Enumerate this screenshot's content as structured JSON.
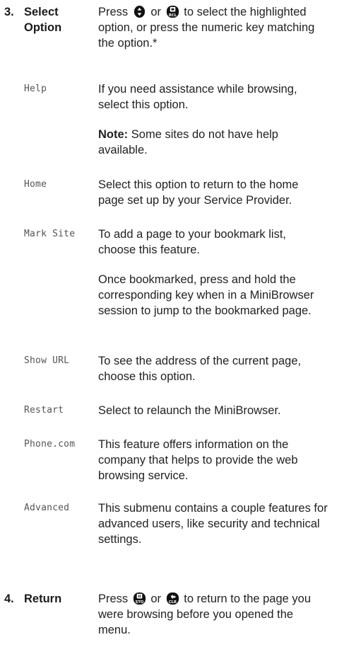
{
  "step3": {
    "number": "3.",
    "title_line1": "Select",
    "title_line2": "Option",
    "desc_a": "Press",
    "desc_or": "or",
    "desc_b": "to select the highlighted",
    "desc_line2": "option, or press the numeric key matching",
    "desc_line3": "the option.*"
  },
  "options": [
    {
      "label": "Help",
      "lines": [
        "If you need assistance while browsing,",
        "select this option."
      ],
      "note_label": "Note:",
      "note_rest": "Some sites do not have help",
      "note_line2": "available."
    },
    {
      "label": "Home",
      "lines": [
        "Select this option to return to the home",
        "page set up by your Service Provider."
      ]
    },
    {
      "label": "Mark Site",
      "lines": [
        "To add a page to your bookmark list,",
        "choose this feature."
      ],
      "extra": [
        "Once bookmarked, press and hold the",
        "corresponding key when in a MiniBrowser",
        "session to jump to the bookmarked page."
      ]
    },
    {
      "label": "Show URL",
      "lines": [
        "To see the address of the current page,",
        "choose this option."
      ]
    },
    {
      "label": "Restart",
      "lines": [
        "Select to relaunch the MiniBrowser."
      ]
    },
    {
      "label": "Phone.com",
      "lines": [
        "This feature offers information on the",
        "company that helps to provide the web",
        "browsing service."
      ]
    },
    {
      "label": "Advanced",
      "lines": [
        "This submenu contains a couple features for",
        "advanced users, like security and technical",
        "settings."
      ]
    }
  ],
  "step4": {
    "number": "4.",
    "title": "Return",
    "desc_a": "Press",
    "desc_or": "or",
    "desc_b": "to return to the page you",
    "desc_line2": "were browsing before you opened the",
    "desc_line3": "menu."
  },
  "icons": {
    "nav_key": "nav-key-icon",
    "rcl_key": "rcl-key-icon",
    "sto_key": "sto-key-icon",
    "clr_key": "clr-key-icon"
  }
}
